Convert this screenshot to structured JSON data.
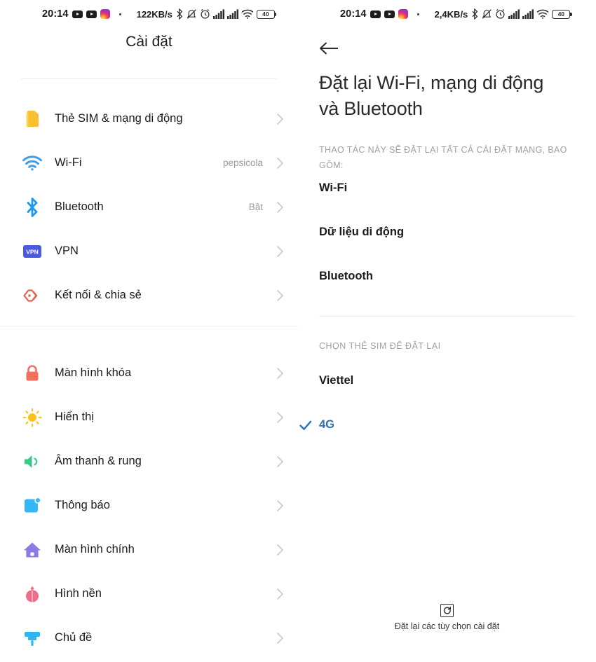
{
  "left_status": {
    "time": "20:14",
    "network_speed": "122KB/s",
    "battery": "40",
    "icons": [
      "youtube-icon",
      "youtube-icon",
      "instagram-icon",
      "dot-icon",
      "bluetooth-icon",
      "mute-icon",
      "alarm-icon",
      "signal-icon",
      "signal-icon",
      "wifi-icon",
      "battery-icon"
    ]
  },
  "right_status": {
    "time": "20:14",
    "network_speed": "2,4KB/s",
    "battery": "40"
  },
  "settings": {
    "title": "Cài đặt",
    "group1": [
      {
        "icon": "sim-card-icon",
        "label": "Thẻ SIM & mạng di động",
        "value": ""
      },
      {
        "icon": "wifi-icon",
        "label": "Wi-Fi",
        "value": "pepsicola"
      },
      {
        "icon": "bluetooth-icon",
        "label": "Bluetooth",
        "value": "Bật"
      },
      {
        "icon": "vpn-icon",
        "label": "VPN",
        "value": ""
      },
      {
        "icon": "share-icon",
        "label": "Kết nối & chia sẻ",
        "value": ""
      }
    ],
    "group2": [
      {
        "icon": "lock-icon",
        "label": "Màn hình khóa",
        "value": ""
      },
      {
        "icon": "brightness-icon",
        "label": "Hiển thị",
        "value": ""
      },
      {
        "icon": "volume-icon",
        "label": "Âm thanh & rung",
        "value": ""
      },
      {
        "icon": "notification-icon",
        "label": "Thông báo",
        "value": ""
      },
      {
        "icon": "home-icon",
        "label": "Màn hình chính",
        "value": ""
      },
      {
        "icon": "flower-icon",
        "label": "Hình nền",
        "value": ""
      },
      {
        "icon": "brush-icon",
        "label": "Chủ đề",
        "value": ""
      }
    ]
  },
  "reset_page": {
    "back_icon": "back-arrow-icon",
    "title": "Đặt lại Wi-Fi, mạng di động và Bluetooth",
    "subtitle": "THAO TÁC NÀY SẼ ĐẶT LẠI TẤT CẢ CÀI ĐẶT MẠNG, BAO GỒM:",
    "items": [
      "Wi-Fi",
      "Dữ liệu di động",
      "Bluetooth"
    ],
    "sim_section_header": "CHỌN THẺ SIM ĐỂ ĐẶT LẠI",
    "sim_name": "Viettel",
    "sim_selected": "4G",
    "reset_button_label": "Đặt lại các tùy chọn cài đặt"
  },
  "colors": {
    "accent_blue": "#2e6fb7",
    "sim_yellow": "#fbc02d",
    "wifi_blue": "#3f9bf0",
    "bluetooth_blue": "#1e9bf0",
    "vpn_purple": "#4a5ae0",
    "share_red": "#e2604f",
    "lock_red": "#f4705e",
    "sun_yellow": "#fcc419",
    "volume_green": "#37ca8b",
    "notification_blue": "#35b6f5",
    "home_purple": "#8b7ae8",
    "flower_pink": "#f06d8a",
    "brush_blue": "#2fb5f0"
  }
}
